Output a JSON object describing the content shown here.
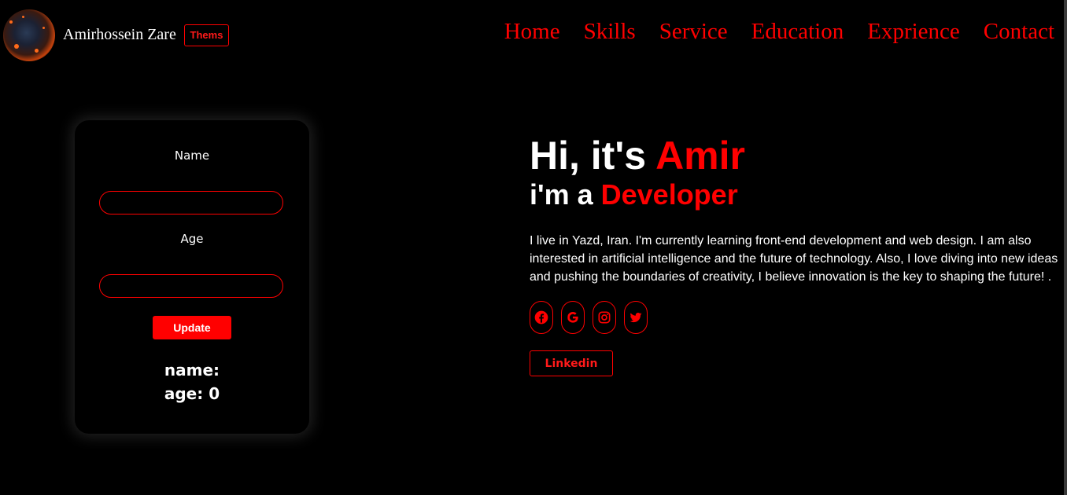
{
  "header": {
    "brand_name": "Amirhossein Zare",
    "theme_button": "Thems",
    "nav": [
      "Home",
      "Skills",
      "Service",
      "Education",
      "Exprience",
      "Contact"
    ]
  },
  "form": {
    "name_label": "Name",
    "name_value": "",
    "age_label": "Age",
    "age_value": "",
    "update_button": "Update",
    "result_name_label": "name:",
    "result_name_value": "",
    "result_age_label": "age:",
    "result_age_value": "0"
  },
  "hero": {
    "greeting": "Hi, it's",
    "name": "Amir",
    "role_prefix": "i'm a",
    "role": "Developer",
    "bio": "I live in Yazd, Iran. I'm currently learning front-end development and web design. I am also interested in artificial intelligence and the future of technology. Also, I love diving into new ideas and pushing the boundaries of creativity, I believe innovation is the key to shaping the future! .",
    "socials": [
      "facebook-icon",
      "google-icon",
      "instagram-icon",
      "twitter-icon"
    ],
    "linkedin_button": "Linkedin"
  },
  "colors": {
    "background": "#000000",
    "accent": "#ff0000",
    "text": "#ffffff"
  }
}
